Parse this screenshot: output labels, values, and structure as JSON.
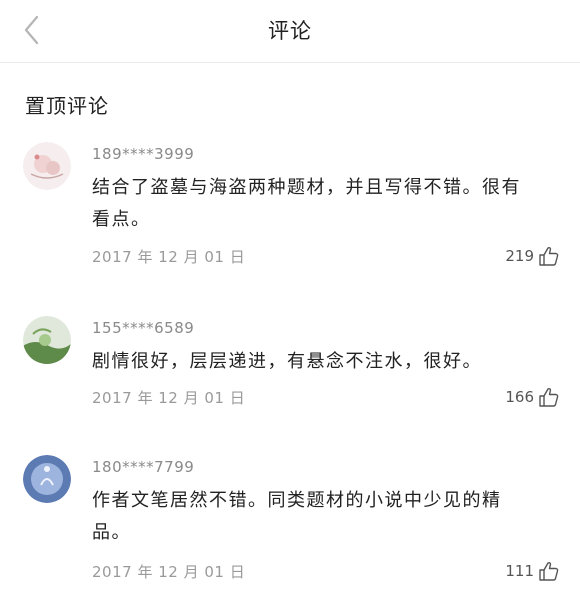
{
  "header": {
    "title": "评论",
    "back_icon": "chevron-left-icon"
  },
  "section": {
    "title": "置顶评论"
  },
  "comments": [
    {
      "user": "189****3999",
      "text_lines": [
        "结合了盗墓与海盗两种题材，并且写得不错。很有",
        "看点。"
      ],
      "date": "2017 年 12 月 01 日",
      "likes": "219"
    },
    {
      "user": "155****6589",
      "text_lines": [
        "剧情很好，层层递进，有悬念不注水，很好。"
      ],
      "date": "2017 年 12 月 01 日",
      "likes": "166"
    },
    {
      "user": "180****7799",
      "text_lines": [
        "作者文笔居然不错。同类题材的小说中少见的精",
        "品。"
      ],
      "date": "2017 年 12 月 01 日",
      "likes": "111"
    }
  ],
  "colors": {
    "text": "#222222",
    "muted": "#9a9a9a",
    "divider": "#ececec"
  }
}
